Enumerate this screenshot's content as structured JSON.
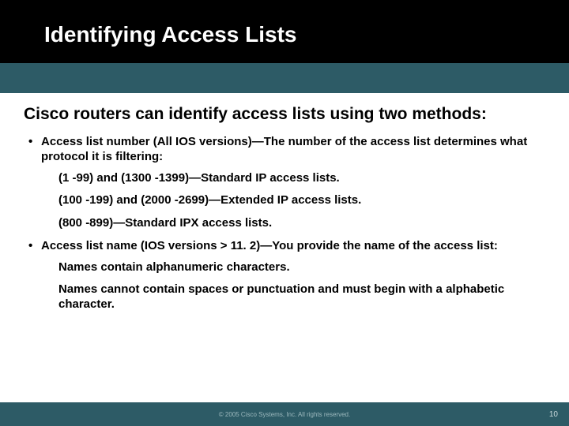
{
  "title": "Identifying Access Lists",
  "intro": "Cisco routers can identify access lists using two methods:",
  "bullets": [
    {
      "text": "Access list number (All IOS versions)—The number of the access list determines what protocol it is filtering:",
      "sub": [
        "(1 -99) and (1300 -1399)—Standard IP access lists.",
        "(100 -199) and (2000 -2699)—Extended IP access lists.",
        "(800 -899)—Standard IPX access lists."
      ]
    },
    {
      "text": "Access list name (IOS versions > 11. 2)—You provide the name of the access list:",
      "sub": [
        "Names contain alphanumeric characters.",
        "Names cannot contain spaces or punctuation and must begin with a alphabetic character."
      ]
    }
  ],
  "footer": "© 2005 Cisco Systems, Inc. All rights reserved.",
  "page": "10"
}
